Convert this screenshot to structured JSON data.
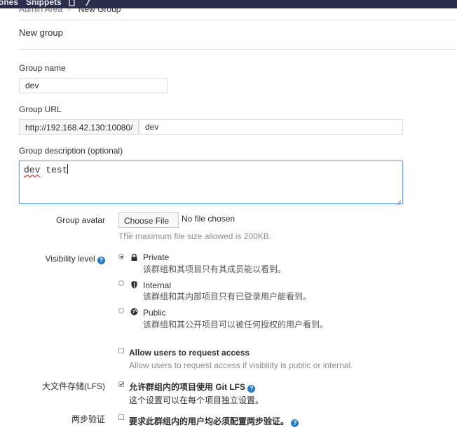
{
  "topbar": {
    "links": [
      "ones",
      "Snippets"
    ]
  },
  "breadcrumb": {
    "parent": "Admin Area",
    "current": "New Group"
  },
  "page_title": "New group",
  "form": {
    "group_name": {
      "label": "Group name",
      "value": "dev"
    },
    "group_url": {
      "label": "Group URL",
      "prefix": "http://192.168.42.130:10080/",
      "value": "dev"
    },
    "description": {
      "label": "Group description (optional)",
      "word1": "dev",
      "word2": " test"
    },
    "avatar": {
      "label": "Group avatar",
      "button": "Choose File ...",
      "status": "No file chosen",
      "hint": "The maximum file size allowed is 200KB."
    },
    "visibility": {
      "label": "Visibility level",
      "selected": "Private",
      "options": [
        {
          "name": "Private",
          "desc": "该群组和其项目只有其成员能以看到。",
          "icon": "lock-icon"
        },
        {
          "name": "Internal",
          "desc": "该群组和其内部项目只有已登录用户能看到。",
          "icon": "shield-icon"
        },
        {
          "name": "Public",
          "desc": "该群组和其公开项目可以被任何授权的用户看到。",
          "icon": "globe-icon"
        }
      ]
    },
    "request_access": {
      "label": "Allow users to request access",
      "hint": "Allow users to request access if visibility is public or internal.",
      "checked": false
    },
    "lfs": {
      "row_label": "大文件存储(LFS)",
      "label": "允许群组内的项目使用 Git LFS",
      "hint": "这个设置可以在每个项目独立设置。",
      "checked": true
    },
    "two_factor": {
      "row_label": "两步验证",
      "label": "要求此群组内的用户均必须配置两步验证。",
      "checked": false
    }
  },
  "colors": {
    "accent": "#1f78d1",
    "topbar": "#2b2d4a",
    "focus_border": "#6ea9e0"
  }
}
